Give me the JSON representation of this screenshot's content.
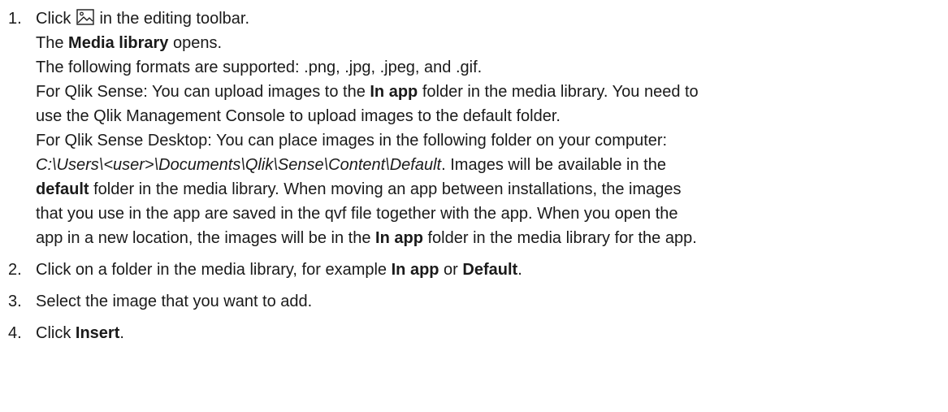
{
  "steps": [
    {
      "number": "1.",
      "lines": {
        "l1": {
          "a": "Click ",
          "b": " in the editing toolbar."
        },
        "l2": {
          "a": "The ",
          "b": "Media library",
          "c": " opens."
        },
        "l3": "The following formats are supported: .png, .jpg, .jpeg, and .gif.",
        "l4": {
          "a": "For Qlik Sense: You can upload images to the ",
          "b": "In app",
          "c": " folder in the media library. You need to"
        },
        "l5": "use the Qlik Management Console to upload images to the default folder.",
        "l6": "For Qlik Sense Desktop: You can place images in the following folder on your computer:",
        "l7": {
          "a": "C:\\Users\\<user>\\Documents\\Qlik\\Sense\\Content\\Default",
          "b": ". Images will be available in the"
        },
        "l8": {
          "a": "default",
          "b": " folder in the media library. When moving an app between installations, the images"
        },
        "l9": "that you use in the app are saved in the qvf file together with the app. When you open the",
        "l10": {
          "a": "app in a new location, the images will be in the ",
          "b": "In app",
          "c": " folder in the media library for the app."
        }
      }
    },
    {
      "number": "2.",
      "lines": {
        "a": "Click on a folder in the media library, for example ",
        "b": "In app",
        "c": " or ",
        "d": "Default",
        "e": "."
      }
    },
    {
      "number": "3.",
      "lines": {
        "a": "Select the image that you want to add."
      }
    },
    {
      "number": "4.",
      "lines": {
        "a": "Click ",
        "b": "Insert",
        "c": "."
      }
    }
  ],
  "icons": {
    "toolbar_image": "image-icon"
  }
}
